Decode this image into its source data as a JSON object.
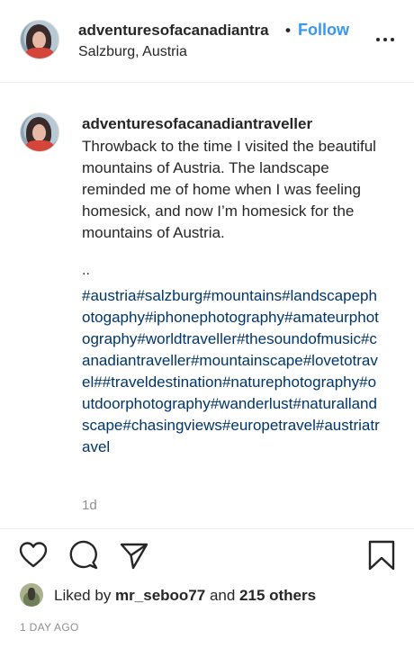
{
  "header": {
    "username": "adventuresofacanadiantra",
    "separator": "•",
    "follow_label": "Follow",
    "location": "Salzburg, Austria"
  },
  "caption": {
    "username": "adventuresofacanadiantraveller",
    "text": "Throwback to the time I visited the beautiful mountains of Austria. The landscape reminded me of home when I was feeling homesick, and now I’m homesick for the mountains of Austria.",
    "dots": "..",
    "hashtags": "#austria#salzburg#mountains#landscapephotogaphy#iphonephotography#amateurphotography#worldtraveller#thesoundofmusic#canadiantraveller#mountainscape#lovetotravel##traveldestination#naturephotography#outdoorphotography#wanderlust#naturallandscape#chasingviews#europetravel#austriatravel",
    "time": "1d"
  },
  "actions": {
    "icons": [
      "heart-icon",
      "comment-icon",
      "share-icon",
      "bookmark-icon"
    ]
  },
  "likes": {
    "prefix": "Liked by ",
    "user": "mr_seboo77",
    "middle": " and ",
    "others": "215 others"
  },
  "timestamp": "1 DAY AGO",
  "colors": {
    "follow": "#3897f0",
    "hashtag": "#003569",
    "muted": "#8e8e8e",
    "text": "#262626"
  }
}
